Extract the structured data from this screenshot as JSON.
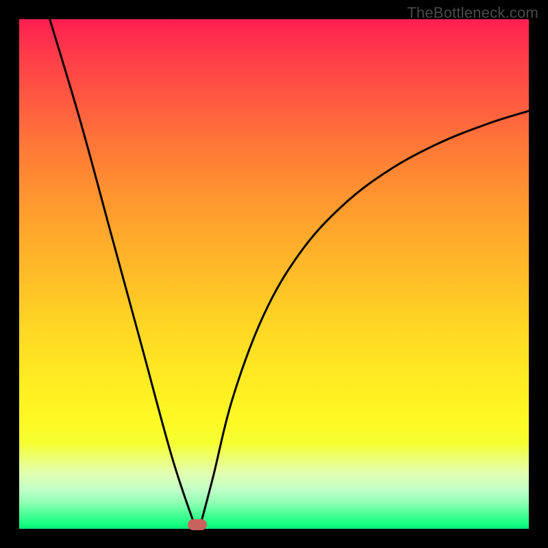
{
  "watermark": "TheBottleneck.com",
  "chart_data": {
    "type": "line",
    "title": "",
    "xlabel": "",
    "ylabel": "",
    "xlim": [
      0,
      100
    ],
    "ylim": [
      0,
      100
    ],
    "grid": false,
    "legend": false,
    "background_gradient": {
      "top": "#ff1f52",
      "mid": "#ffe022",
      "bottom": "#04e873"
    },
    "series": [
      {
        "name": "left-branch",
        "x": [
          6,
          12,
          18,
          24,
          30,
          34.5
        ],
        "y": [
          100,
          80,
          58,
          36,
          14,
          0.5
        ]
      },
      {
        "name": "right-branch",
        "x": [
          35.5,
          38,
          42,
          48,
          55,
          63,
          72,
          82,
          92,
          100
        ],
        "y": [
          0.5,
          10,
          26,
          42,
          54,
          63,
          70,
          75.5,
          79.5,
          82
        ]
      }
    ],
    "marker": {
      "x": 35,
      "y": 0.8,
      "shape": "rounded-rect",
      "color": "#c9615d"
    }
  }
}
